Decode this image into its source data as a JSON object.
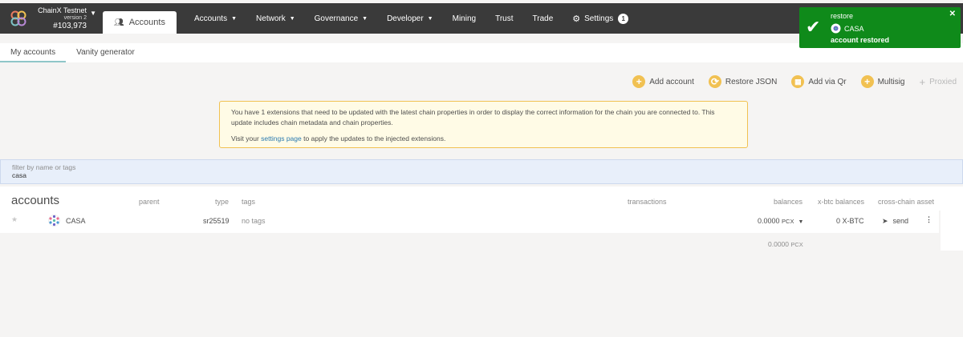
{
  "chain": {
    "name": "ChainX Testnet",
    "version": "version 2",
    "block": "#103,973"
  },
  "topnav": {
    "active_tab": "Accounts",
    "items": [
      {
        "label": "Accounts",
        "has_caret": true
      },
      {
        "label": "Network",
        "has_caret": true
      },
      {
        "label": "Governance",
        "has_caret": true
      },
      {
        "label": "Developer",
        "has_caret": true
      },
      {
        "label": "Mining",
        "has_caret": false
      },
      {
        "label": "Trust",
        "has_caret": false
      },
      {
        "label": "Trade",
        "has_caret": false
      }
    ],
    "settings_label": "Settings",
    "settings_badge": "1"
  },
  "subtabs": [
    "My accounts",
    "Vanity generator"
  ],
  "actions": {
    "add_account": "Add account",
    "restore_json": "Restore JSON",
    "add_via_qr": "Add via Qr",
    "multisig": "Multisig",
    "proxied": "Proxied"
  },
  "warning": {
    "line1": "You have 1 extensions that need to be updated with the latest chain properties in order to display the correct information for the chain you are connected to. This update includes chain metadata and chain properties.",
    "line2_pre": "Visit your ",
    "line2_link": "settings page",
    "line2_post": " to apply the updates to the injected extensions."
  },
  "filter": {
    "label": "filter by name or tags",
    "value": "casa"
  },
  "table": {
    "title": "accounts",
    "headers": {
      "parent": "parent",
      "type": "type",
      "tags": "tags",
      "transactions": "transactions",
      "balances": "balances",
      "xbtc_balances": "x-btc balances",
      "cross_chain": "cross-chain asset"
    },
    "rows": [
      {
        "name": "CASA",
        "type": "sr25519",
        "tags": "no tags",
        "balance": "0.0000",
        "balance_unit": "PCX",
        "xbtc": "0 X-BTC",
        "send_label": "send"
      }
    ],
    "total": "0.0000",
    "total_unit": "PCX"
  },
  "toast": {
    "action": "restore",
    "account": "CASA",
    "message": "account restored"
  },
  "colors": {
    "topbar": "#3a3a3a",
    "accent": "#f1c152",
    "success": "#0f8a1a",
    "filter_bg": "#e8effa"
  }
}
